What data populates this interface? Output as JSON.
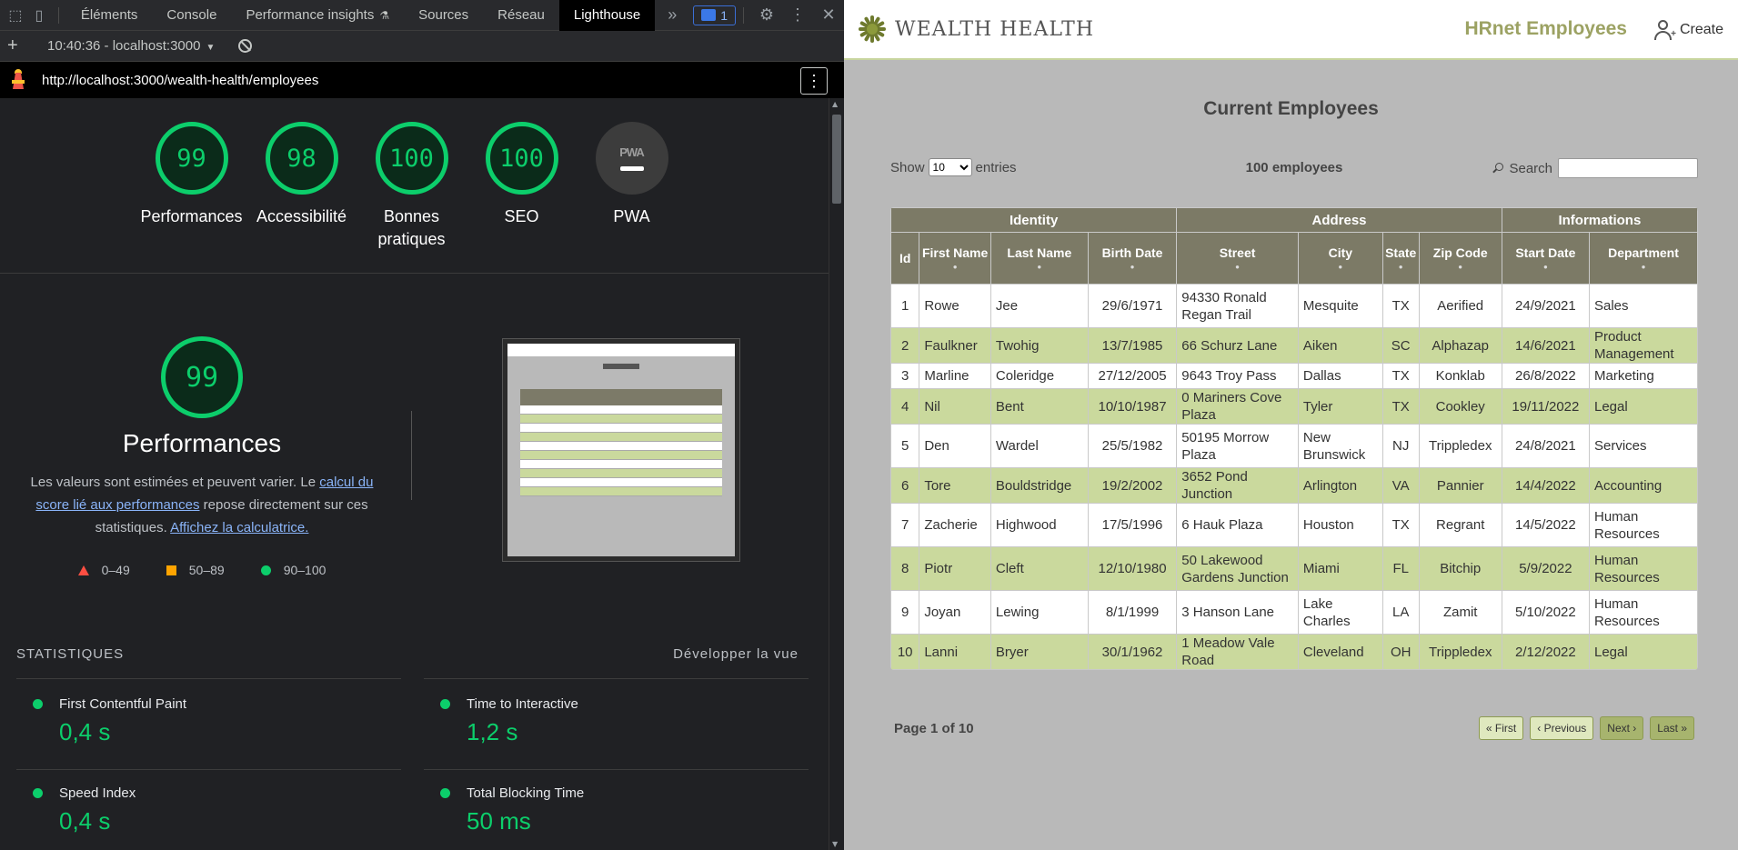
{
  "devtools": {
    "tabs": [
      "Éléments",
      "Console",
      "Performance insights",
      "Sources",
      "Réseau",
      "Lighthouse"
    ],
    "active_tab": "Lighthouse",
    "more_tabs": "»",
    "issues_count": "1",
    "run_label": "10:40:36 - localhost:3000",
    "url": "http://localhost:3000/wealth-health/employees",
    "scores": [
      {
        "value": "99",
        "label": "Performances"
      },
      {
        "value": "98",
        "label": "Accessibilité"
      },
      {
        "value": "100",
        "label": "Bonnes pratiques"
      },
      {
        "value": "100",
        "label": "SEO"
      }
    ],
    "pwa": {
      "badge": "PWA",
      "label": "PWA"
    },
    "performance": {
      "score": "99",
      "title": "Performances",
      "desc_1": "Les valeurs sont estimées et peuvent varier. Le ",
      "desc_link_1": "calcul du score lié aux performances",
      "desc_2": " repose directement sur ces statistiques. ",
      "desc_link_2": "Affichez la calculatrice."
    },
    "legend": [
      "0–49",
      "50–89",
      "90–100"
    ],
    "stats_title": "STATISTIQUES",
    "expand_view": "Développer la vue",
    "metrics": [
      {
        "name": "First Contentful Paint",
        "value": "0,4 s"
      },
      {
        "name": "Time to Interactive",
        "value": "1,2 s"
      },
      {
        "name": "Speed Index",
        "value": "0,4 s"
      },
      {
        "name": "Total Blocking Time",
        "value": "50 ms"
      }
    ],
    "colors": {
      "pass": "#0cce6b",
      "average": "#ffa400",
      "fail": "#ff4e42"
    }
  },
  "app": {
    "brand": "WEALTH HEALTH",
    "title": "HRnet Employees",
    "create": "Create",
    "page_title": "Current Employees",
    "show_label": "Show",
    "entries_label": "entries",
    "entries_value": "10",
    "employee_count": "100 employees",
    "search_label": "Search",
    "groups": [
      "Identity",
      "Address",
      "Informations"
    ],
    "columns": [
      "Id",
      "First Name",
      "Last Name",
      "Birth Date",
      "Street",
      "City",
      "State",
      "Zip Code",
      "Start Date",
      "Department"
    ],
    "rows": [
      [
        "1",
        "Rowe",
        "Jee",
        "29/6/1971",
        "94330 Ronald Regan Trail",
        "Mesquite",
        "TX",
        "Aerified",
        "24/9/2021",
        "Sales"
      ],
      [
        "2",
        "Faulkner",
        "Twohig",
        "13/7/1985",
        "66 Schurz Lane",
        "Aiken",
        "SC",
        "Alphazap",
        "14/6/2021",
        "Product Management"
      ],
      [
        "3",
        "Marline",
        "Coleridge",
        "27/12/2005",
        "9643 Troy Pass",
        "Dallas",
        "TX",
        "Konklab",
        "26/8/2022",
        "Marketing"
      ],
      [
        "4",
        "Nil",
        "Bent",
        "10/10/1987",
        "0 Mariners Cove Plaza",
        "Tyler",
        "TX",
        "Cookley",
        "19/11/2022",
        "Legal"
      ],
      [
        "5",
        "Den",
        "Wardel",
        "25/5/1982",
        "50195 Morrow Plaza",
        "New Brunswick",
        "NJ",
        "Trippledex",
        "24/8/2021",
        "Services"
      ],
      [
        "6",
        "Tore",
        "Bouldstridge",
        "19/2/2002",
        "3652 Pond Junction",
        "Arlington",
        "VA",
        "Pannier",
        "14/4/2022",
        "Accounting"
      ],
      [
        "7",
        "Zacherie",
        "Highwood",
        "17/5/1996",
        "6 Hauk Plaza",
        "Houston",
        "TX",
        "Regrant",
        "14/5/2022",
        "Human Resources"
      ],
      [
        "8",
        "Piotr",
        "Cleft",
        "12/10/1980",
        "50 Lakewood Gardens Junction",
        "Miami",
        "FL",
        "Bitchip",
        "5/9/2022",
        "Human Resources"
      ],
      [
        "9",
        "Joyan",
        "Lewing",
        "8/1/1999",
        "3 Hanson Lane",
        "Lake Charles",
        "LA",
        "Zamit",
        "5/10/2022",
        "Human Resources"
      ],
      [
        "10",
        "Lanni",
        "Bryer",
        "30/1/1962",
        "1 Meadow Vale Road",
        "Cleveland",
        "OH",
        "Trippledex",
        "2/12/2022",
        "Legal"
      ]
    ],
    "page_info": "Page 1 of 10",
    "pager": [
      "« First",
      "‹ Previous",
      "Next ›",
      "Last »"
    ],
    "colors": {
      "header": "#7c7a66",
      "row_alt": "#cad99d",
      "accent": "#9ca263"
    }
  }
}
